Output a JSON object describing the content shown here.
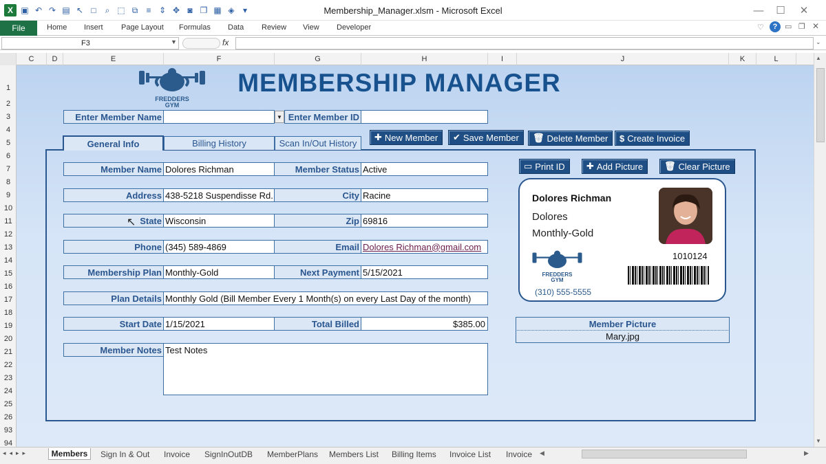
{
  "window": {
    "title": "Membership_Manager.xlsm  -  Microsoft Excel"
  },
  "ribbon": {
    "file": "File",
    "tabs": [
      "Home",
      "Insert",
      "Page Layout",
      "Formulas",
      "Data",
      "Review",
      "View",
      "Developer"
    ]
  },
  "formula_bar": {
    "name_box": "F3",
    "fx": "fx",
    "content": ""
  },
  "columns": [
    "C",
    "D",
    "E",
    "F",
    "G",
    "H",
    "I",
    "J",
    "K",
    "L"
  ],
  "rows": [
    "1",
    "2",
    "3",
    "4",
    "5",
    "6",
    "7",
    "8",
    "9",
    "10",
    "11",
    "12",
    "13",
    "14",
    "15",
    "16",
    "17",
    "18",
    "19",
    "20",
    "21",
    "22",
    "23",
    "24",
    "25",
    "26",
    "93",
    "94"
  ],
  "app": {
    "title": "MEMBERSHIP MANAGER",
    "logo_line1": "FREDDERS",
    "logo_line2": "GYM",
    "search": {
      "name_label": "Enter Member Name",
      "name_value": "",
      "id_label": "Enter Member ID",
      "id_value": ""
    },
    "buttons": {
      "new": "New Member",
      "save": "Save Member",
      "delete": "Delete Member",
      "invoice": "Create Invoice",
      "print": "Print ID",
      "add_pic": "Add Picture",
      "clear_pic": "Clear Picture"
    },
    "tabs": [
      "General Info",
      "Billing History",
      "Scan In/Out History"
    ],
    "fields": {
      "member_name": {
        "label": "Member Name",
        "value": "Dolores Richman"
      },
      "member_status": {
        "label": "Member Status",
        "value": "Active"
      },
      "address": {
        "label": "Address",
        "value": "438-5218 Suspendisse Rd."
      },
      "city": {
        "label": "City",
        "value": "Racine"
      },
      "state": {
        "label": "State",
        "value": "Wisconsin"
      },
      "zip": {
        "label": "Zip",
        "value": "69816"
      },
      "phone": {
        "label": "Phone",
        "value": "(345) 589-4869"
      },
      "email": {
        "label": "Email",
        "value": "Dolores Richman@gmail.com"
      },
      "plan": {
        "label": "Membership Plan",
        "value": "Monthly-Gold"
      },
      "next_payment": {
        "label": "Next Payment",
        "value": "5/15/2021"
      },
      "plan_details": {
        "label": "Plan Details",
        "value": "Monthly Gold (Bill Member Every 1 Month(s) on every Last Day of the month)"
      },
      "start_date": {
        "label": "Start Date",
        "value": "1/15/2021"
      },
      "total_billed": {
        "label": "Total Billed",
        "value": "$385.00"
      },
      "notes": {
        "label": "Member Notes",
        "value": "Test Notes"
      }
    },
    "card": {
      "name": "Dolores Richman",
      "first": "Dolores",
      "plan": "Monthly-Gold",
      "id": "1010124",
      "phone": "(310) 555-5555"
    },
    "picture": {
      "label": "Member Picture",
      "file": "Mary.jpg"
    }
  },
  "sheet_tabs": [
    "Members",
    "Sign In & Out",
    "Invoice",
    "SignInOutDB",
    "MemberPlans",
    "Members List",
    "Billing Items",
    "Invoice List",
    "Invoice"
  ],
  "colors": {
    "accent": "#17528f",
    "button": "#1f4e84",
    "excel_green": "#1e7145"
  }
}
